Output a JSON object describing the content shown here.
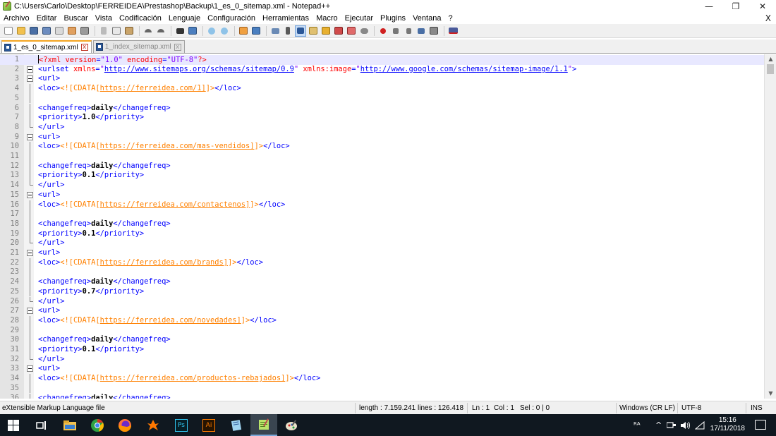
{
  "window": {
    "title": "C:\\Users\\Carlo\\Desktop\\FERREIDEA\\Prestashop\\Backup\\1_es_0_sitemap.xml - Notepad++",
    "minimize": "—",
    "maximize": "❐",
    "close": "✕"
  },
  "menu": {
    "items": [
      "Archivo",
      "Editar",
      "Buscar",
      "Vista",
      "Codificación",
      "Lenguaje",
      "Configuración",
      "Herramientas",
      "Macro",
      "Ejecutar",
      "Plugins",
      "Ventana",
      "?"
    ],
    "close_doc": "X"
  },
  "tabs": [
    {
      "label": "1_es_0_sitemap.xml",
      "active": true,
      "close": "x"
    },
    {
      "label": "1_index_sitemap.xml",
      "active": false,
      "close": "x"
    }
  ],
  "editor": {
    "lines": [
      {
        "n": "1",
        "fold": "none",
        "parts": [
          [
            "pi",
            "<?xml "
          ],
          [
            "attr",
            "version"
          ],
          [
            "tag",
            "="
          ],
          [
            "val",
            "\"1.0\""
          ],
          [
            "attr",
            " encoding"
          ],
          [
            "tag",
            "="
          ],
          [
            "val",
            "\"UTF-8\""
          ],
          [
            "pi",
            "?>"
          ]
        ]
      },
      {
        "n": "2",
        "fold": "box",
        "parts": [
          [
            "tag",
            "<urlset "
          ],
          [
            "attr",
            "xmlns"
          ],
          [
            "tag",
            "="
          ],
          [
            "val",
            "\""
          ],
          [
            "url",
            "http://www.sitemaps.org/schemas/sitemap/0.9"
          ],
          [
            "val",
            "\""
          ],
          [
            "attr",
            " xmlns:image"
          ],
          [
            "tag",
            "="
          ],
          [
            "val",
            "\""
          ],
          [
            "url",
            "http://www.google.com/schemas/sitemap-image/1.1"
          ],
          [
            "val",
            "\""
          ],
          [
            "tag",
            ">"
          ]
        ]
      },
      {
        "n": "3",
        "fold": "box",
        "parts": [
          [
            "tag",
            "<url>"
          ]
        ]
      },
      {
        "n": "4",
        "fold": "vline",
        "parts": [
          [
            "tag",
            "<loc>"
          ],
          [
            "cdata",
            "<![CDATA["
          ],
          [
            "cdataurl",
            "https://ferreidea.com/1]"
          ],
          [
            "cdata",
            "]>"
          ],
          [
            "tag",
            "</loc>"
          ]
        ]
      },
      {
        "n": "5",
        "fold": "vline",
        "parts": []
      },
      {
        "n": "6",
        "fold": "vline",
        "parts": [
          [
            "tag",
            "<changefreq>"
          ],
          [
            "txt",
            "daily"
          ],
          [
            "tag",
            "</changefreq>"
          ]
        ]
      },
      {
        "n": "7",
        "fold": "vline",
        "parts": [
          [
            "tag",
            "<priority>"
          ],
          [
            "txt",
            "1.0"
          ],
          [
            "tag",
            "</priority>"
          ]
        ]
      },
      {
        "n": "8",
        "fold": "end",
        "parts": [
          [
            "tag",
            "</url>"
          ]
        ]
      },
      {
        "n": "9",
        "fold": "box",
        "parts": [
          [
            "tag",
            "<url>"
          ]
        ]
      },
      {
        "n": "10",
        "fold": "vline",
        "parts": [
          [
            "tag",
            "<loc>"
          ],
          [
            "cdata",
            "<![CDATA["
          ],
          [
            "cdataurl",
            "https://ferreidea.com/mas-vendidos]"
          ],
          [
            "cdata",
            "]>"
          ],
          [
            "tag",
            "</loc>"
          ]
        ]
      },
      {
        "n": "11",
        "fold": "vline",
        "parts": []
      },
      {
        "n": "12",
        "fold": "vline",
        "parts": [
          [
            "tag",
            "<changefreq>"
          ],
          [
            "txt",
            "daily"
          ],
          [
            "tag",
            "</changefreq>"
          ]
        ]
      },
      {
        "n": "13",
        "fold": "vline",
        "parts": [
          [
            "tag",
            "<priority>"
          ],
          [
            "txt",
            "0.1"
          ],
          [
            "tag",
            "</priority>"
          ]
        ]
      },
      {
        "n": "14",
        "fold": "end",
        "parts": [
          [
            "tag",
            "</url>"
          ]
        ]
      },
      {
        "n": "15",
        "fold": "box",
        "parts": [
          [
            "tag",
            "<url>"
          ]
        ]
      },
      {
        "n": "16",
        "fold": "vline",
        "parts": [
          [
            "tag",
            "<loc>"
          ],
          [
            "cdata",
            "<![CDATA["
          ],
          [
            "cdataurl",
            "https://ferreidea.com/contactenos]"
          ],
          [
            "cdata",
            "]>"
          ],
          [
            "tag",
            "</loc>"
          ]
        ]
      },
      {
        "n": "17",
        "fold": "vline",
        "parts": []
      },
      {
        "n": "18",
        "fold": "vline",
        "parts": [
          [
            "tag",
            "<changefreq>"
          ],
          [
            "txt",
            "daily"
          ],
          [
            "tag",
            "</changefreq>"
          ]
        ]
      },
      {
        "n": "19",
        "fold": "vline",
        "parts": [
          [
            "tag",
            "<priority>"
          ],
          [
            "txt",
            "0.1"
          ],
          [
            "tag",
            "</priority>"
          ]
        ]
      },
      {
        "n": "20",
        "fold": "end",
        "parts": [
          [
            "tag",
            "</url>"
          ]
        ]
      },
      {
        "n": "21",
        "fold": "box",
        "parts": [
          [
            "tag",
            "<url>"
          ]
        ]
      },
      {
        "n": "22",
        "fold": "vline",
        "parts": [
          [
            "tag",
            "<loc>"
          ],
          [
            "cdata",
            "<![CDATA["
          ],
          [
            "cdataurl",
            "https://ferreidea.com/brands]"
          ],
          [
            "cdata",
            "]>"
          ],
          [
            "tag",
            "</loc>"
          ]
        ]
      },
      {
        "n": "23",
        "fold": "vline",
        "parts": []
      },
      {
        "n": "24",
        "fold": "vline",
        "parts": [
          [
            "tag",
            "<changefreq>"
          ],
          [
            "txt",
            "daily"
          ],
          [
            "tag",
            "</changefreq>"
          ]
        ]
      },
      {
        "n": "25",
        "fold": "vline",
        "parts": [
          [
            "tag",
            "<priority>"
          ],
          [
            "txt",
            "0.7"
          ],
          [
            "tag",
            "</priority>"
          ]
        ]
      },
      {
        "n": "26",
        "fold": "end",
        "parts": [
          [
            "tag",
            "</url>"
          ]
        ]
      },
      {
        "n": "27",
        "fold": "box",
        "parts": [
          [
            "tag",
            "<url>"
          ]
        ]
      },
      {
        "n": "28",
        "fold": "vline",
        "parts": [
          [
            "tag",
            "<loc>"
          ],
          [
            "cdata",
            "<![CDATA["
          ],
          [
            "cdataurl",
            "https://ferreidea.com/novedades]"
          ],
          [
            "cdata",
            "]>"
          ],
          [
            "tag",
            "</loc>"
          ]
        ]
      },
      {
        "n": "29",
        "fold": "vline",
        "parts": []
      },
      {
        "n": "30",
        "fold": "vline",
        "parts": [
          [
            "tag",
            "<changefreq>"
          ],
          [
            "txt",
            "daily"
          ],
          [
            "tag",
            "</changefreq>"
          ]
        ]
      },
      {
        "n": "31",
        "fold": "vline",
        "parts": [
          [
            "tag",
            "<priority>"
          ],
          [
            "txt",
            "0.1"
          ],
          [
            "tag",
            "</priority>"
          ]
        ]
      },
      {
        "n": "32",
        "fold": "end",
        "parts": [
          [
            "tag",
            "</url>"
          ]
        ]
      },
      {
        "n": "33",
        "fold": "box",
        "parts": [
          [
            "tag",
            "<url>"
          ]
        ]
      },
      {
        "n": "34",
        "fold": "vline",
        "parts": [
          [
            "tag",
            "<loc>"
          ],
          [
            "cdata",
            "<![CDATA["
          ],
          [
            "cdataurl",
            "https://ferreidea.com/productos-rebajados]"
          ],
          [
            "cdata",
            "]>"
          ],
          [
            "tag",
            "</loc>"
          ]
        ]
      },
      {
        "n": "35",
        "fold": "vline",
        "parts": []
      },
      {
        "n": "36",
        "fold": "vline",
        "parts": [
          [
            "tag",
            "<changefreq>"
          ],
          [
            "txt",
            "daily"
          ],
          [
            "tag",
            "</changefreq>"
          ]
        ]
      }
    ]
  },
  "statusbar": {
    "file_type": "eXtensible Markup Language file",
    "length": "length : 7.159.241",
    "lines": "lines : 126.418",
    "ln": "Ln : 1",
    "col": "Col : 1",
    "sel": "Sel : 0 | 0",
    "eol": "Windows (CR LF)",
    "encoding": "UTF-8",
    "mode": "INS"
  },
  "taskbar": {
    "apps": [
      "windows-start-icon",
      "task-view-icon",
      "file-explorer-icon",
      "chrome-icon",
      "firefox-icon",
      "avast-icon",
      "photoshop-icon",
      "illustrator-icon",
      "notepad-icon",
      "notepadpp-icon",
      "paint-icon"
    ],
    "ps_label": "Ps",
    "ai_label": "Ai",
    "tray_user": "ᴿᴬ",
    "tray_up": "^",
    "clock_time": "15:16",
    "clock_date": "17/11/2018"
  }
}
